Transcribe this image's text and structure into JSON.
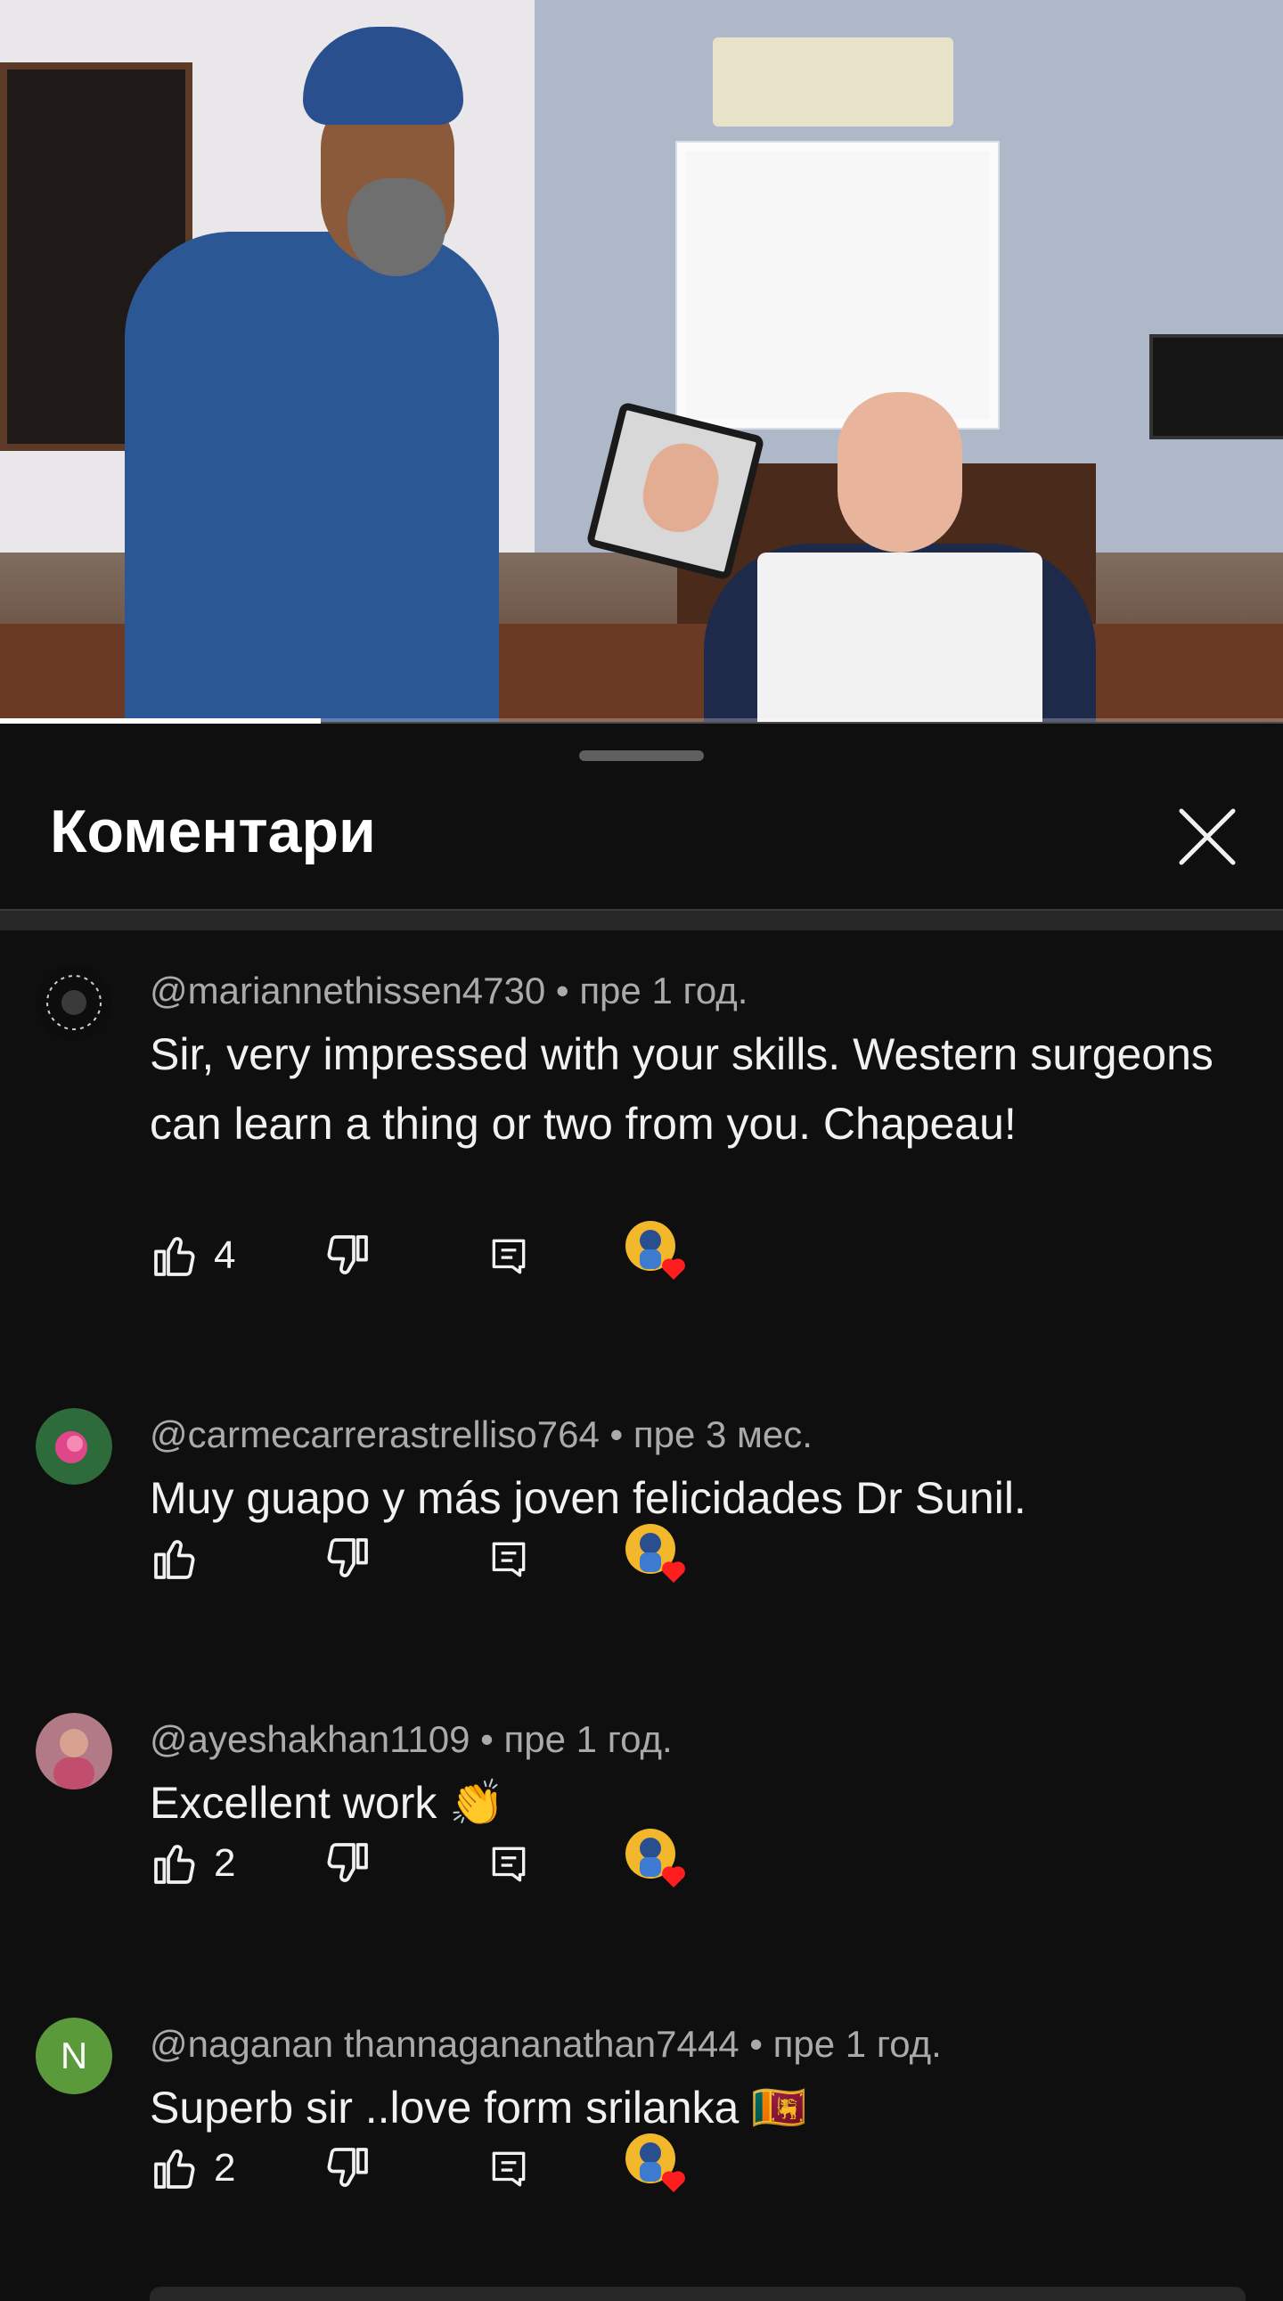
{
  "video": {
    "progress_fraction": 0.25
  },
  "sheet": {
    "title": "Коментари"
  },
  "comments": [
    {
      "author": "@mariannethissen4730",
      "time": "пре 1 год.",
      "text": "Sir, very impressed with your skills. Western surgeons can learn a thing or two from you. Chapeau!",
      "likes": "4",
      "avatar_letter": "",
      "avatar_color": "#111111"
    },
    {
      "author": "@carmecarrerastrelliso764",
      "time": "пре 3 мес.",
      "text": "Muy guapo y  más joven felicidades Dr Sunil.",
      "likes": "",
      "avatar_letter": "",
      "avatar_color": "#2e6b3a"
    },
    {
      "author": "@ayeshakhan1109",
      "time": "пре 1 год.",
      "text": "Excellent work 👏",
      "likes": "2",
      "avatar_letter": "",
      "avatar_color": "#b27a86"
    },
    {
      "author": "@naganan thannagananathan7444",
      "time": "пре 1 год.",
      "text": "Superb sir ..love form srilanka 🇱🇰",
      "likes": "2",
      "avatar_letter": "N",
      "avatar_color": "#5a9a3a"
    }
  ],
  "separator": "•",
  "icons": {
    "like": "thumb-up-icon",
    "dislike": "thumb-down-icon",
    "reply": "reply-comment-icon",
    "creator_heart": "creator-heart-icon",
    "close": "close-icon"
  }
}
